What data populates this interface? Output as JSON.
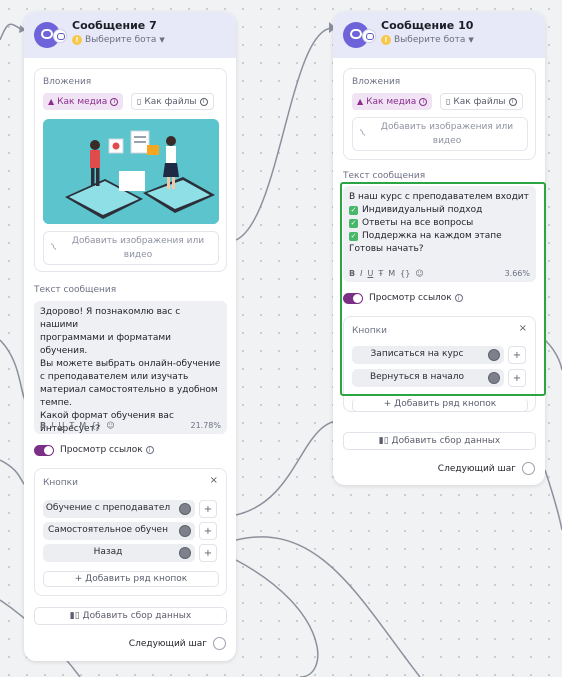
{
  "cards": [
    {
      "title": "Сообщение 7",
      "bot_select": "Выберите бота",
      "attachments_label": "Вложения",
      "tab_media": "Как медиа",
      "tab_files": "Как файлы",
      "upload_text": "Добавить изображения или\nвидео",
      "message_label": "Текст сообщения",
      "message_text": "Здорово! Я познакомлю вас с нашими\nпрограммами и форматами обучения.\nВы можете выбрать онлайн-обучение\nс преподавателем или изучать\nматериал самостоятельно в удобном\nтемпе.\nКакой формат обучения вас\nинтересует?",
      "format_tools": [
        "B",
        "I",
        "U",
        "Ŧ",
        "M",
        "{}",
        "☺"
      ],
      "fill_percent": "21.78%",
      "link_preview": "Просмотр ссылок",
      "buttons_label": "Кнопки",
      "buttons": [
        "Обучение с преподавател",
        "Самостоятельное обучен",
        "Назад"
      ],
      "add_row": "+ Добавить ряд кнопок",
      "add_collect": "Добавить сбор данных",
      "next_step": "Следующий шаг"
    },
    {
      "title": "Сообщение 10",
      "bot_select": "Выберите бота",
      "attachments_label": "Вложения",
      "tab_media": "Как медиа",
      "tab_files": "Как файлы",
      "upload_text": "Добавить изображения или\nвидео",
      "message_label": "Текст сообщения",
      "message_intro": "В наш курс с преподавателем входит",
      "checklist": [
        "Индивидуальный подход",
        "Ответы на все вопросы",
        "Поддержка на каждом этапе"
      ],
      "message_outro": "Готовы начать?",
      "format_tools": [
        "B",
        "I",
        "U",
        "Ŧ",
        "M",
        "{}",
        "☺"
      ],
      "fill_percent": "3.66%",
      "link_preview": "Просмотр ссылок",
      "buttons_label": "Кнопки",
      "buttons": [
        "Записаться на курс",
        "Вернуться в начало"
      ],
      "add_row": "+ Добавить ряд кнопок",
      "add_collect": "Добавить сбор данных",
      "next_step": "Следующий шаг"
    }
  ],
  "colors": {
    "accent_purple": "#7b2f86",
    "highlight_green": "#2aa542",
    "header_bg": "#e7e9f8"
  }
}
